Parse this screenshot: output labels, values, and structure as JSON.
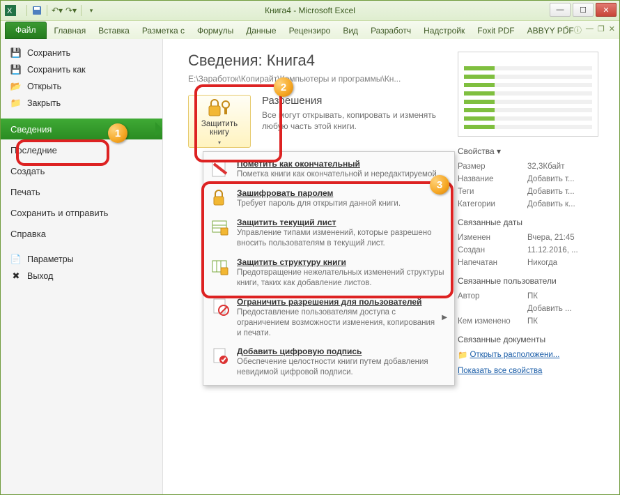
{
  "title": "Книга4  -  Microsoft Excel",
  "qat": {
    "save": "save-icon",
    "undo": "undo-icon",
    "redo": "redo-icon"
  },
  "tabs": {
    "file": "Файл",
    "items": [
      "Главная",
      "Вставка",
      "Разметка с",
      "Формулы",
      "Данные",
      "Рецензиро",
      "Вид",
      "Разработч",
      "Надстройк",
      "Foxit PDF",
      "ABBYY PDF"
    ]
  },
  "sidebar": {
    "top": [
      {
        "icon": "💾",
        "label": "Сохранить"
      },
      {
        "icon": "💾",
        "label": "Сохранить как"
      },
      {
        "icon": "📂",
        "label": "Открыть"
      },
      {
        "icon": "📁",
        "label": "Закрыть"
      }
    ],
    "nav": [
      {
        "label": "Сведения",
        "active": true
      },
      {
        "label": "Последние"
      },
      {
        "label": "Создать"
      },
      {
        "label": "Печать"
      },
      {
        "label": "Сохранить и отправить"
      },
      {
        "label": "Справка"
      }
    ],
    "bottom": [
      {
        "icon": "⚙",
        "label": "Параметры"
      },
      {
        "icon": "✖",
        "label": "Выход"
      }
    ]
  },
  "info": {
    "heading": "Сведения: Книга4",
    "path": "E:\\Заработок\\Копирайт\\Компьютеры и программы\\Кн...",
    "protect": {
      "button": "Защитить книгу",
      "title": "Разрешения",
      "desc": "Все могут открывать, копировать и изменять любую часть этой книги."
    }
  },
  "dropdown": [
    {
      "title": "Пометить как окончательный",
      "desc": "Пометка книги как окончательной и нередактируемой."
    },
    {
      "title": "Зашифровать паролем",
      "desc": "Требует пароль для открытия данной книги."
    },
    {
      "title": "Защитить текущий лист",
      "desc": "Управление типами изменений, которые разрешено вносить пользователям в текущий лист."
    },
    {
      "title": "Защитить структуру книги",
      "desc": "Предотвращение нежелательных изменений структуры книги, таких как добавление листов."
    },
    {
      "title": "Ограничить разрешения для пользователей",
      "desc": "Предоставление пользователям доступа с ограничением возможности изменения, копирования и печати.",
      "arrow": true
    },
    {
      "title": "Добавить цифровую подпись",
      "desc": "Обеспечение целостности книги путем добавления невидимой цифровой подписи."
    }
  ],
  "right": {
    "props_h": "Свойства ▾",
    "rows1": [
      {
        "k": "Размер",
        "v": "32,3Кбайт"
      },
      {
        "k": "Название",
        "v": "Добавить т..."
      },
      {
        "k": "Теги",
        "v": "Добавить т..."
      },
      {
        "k": "Категории",
        "v": "Добавить к..."
      }
    ],
    "dates_h": "Связанные даты",
    "rows2": [
      {
        "k": "Изменен",
        "v": "Вчера, 21:45"
      },
      {
        "k": "Создан",
        "v": "11.12.2016, ..."
      },
      {
        "k": "Напечатан",
        "v": "Никогда"
      }
    ],
    "users_h": "Связанные пользователи",
    "rows3": [
      {
        "k": "Автор",
        "v": "ПК"
      },
      {
        "k": "",
        "v": "Добавить ..."
      },
      {
        "k": "Кем изменено",
        "v": "ПК"
      }
    ],
    "docs_h": "Связанные документы",
    "open_loc": "Открыть расположени...",
    "all_props": "Показать все свойства"
  },
  "badges": {
    "1": "1",
    "2": "2",
    "3": "3"
  }
}
